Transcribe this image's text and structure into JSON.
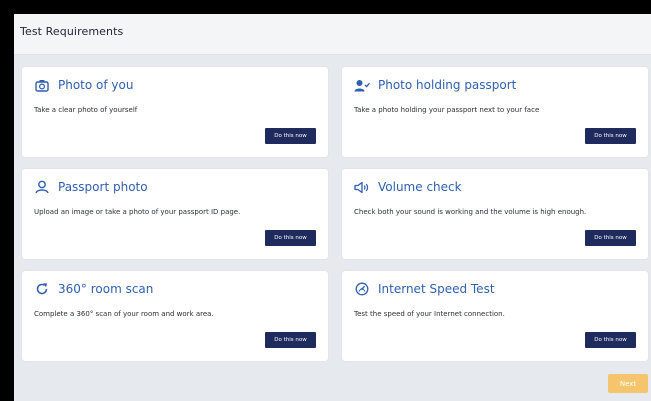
{
  "header": {
    "title": "Test Requirements"
  },
  "cards": [
    {
      "title": "Photo of you",
      "description": "Take a clear photo of yourself",
      "button": "Do this now",
      "icon": "camera-icon"
    },
    {
      "title": "Photo holding passport",
      "description": "Take a photo holding your passport next to your face",
      "button": "Do this now",
      "icon": "user-check-icon"
    },
    {
      "title": "Passport photo",
      "description": "Upload an image or take a photo of your passport ID page.",
      "button": "Do this now",
      "icon": "user-outline-icon"
    },
    {
      "title": "Volume check",
      "description": "Check both your sound is working and the volume is high enough.",
      "button": "Do this now",
      "icon": "speaker-icon"
    },
    {
      "title": "360° room scan",
      "description": "Complete a 360° scan of your room and work area.",
      "button": "Do this now",
      "icon": "rotate-icon"
    },
    {
      "title": "Internet Speed Test",
      "description": "Test the speed of your Internet connection.",
      "button": "Do this now",
      "icon": "speed-icon"
    }
  ],
  "footer": {
    "next_label": "Next"
  },
  "colors": {
    "accent": "#2f5fb0",
    "button": "#1f2b5c",
    "next": "#f5c56d",
    "background": "#e6e9ee"
  }
}
